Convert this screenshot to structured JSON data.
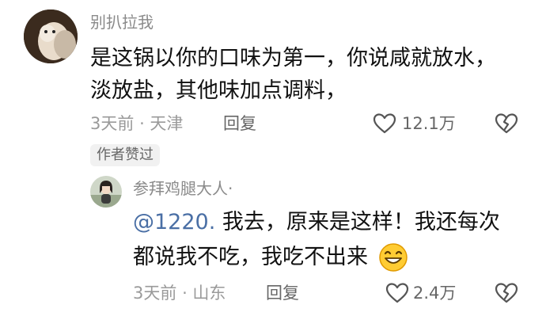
{
  "comment": {
    "author": "别扒拉我",
    "text_line1": "是这锅以你的口味为第一，你说咸就放水，",
    "text_line2": "淡放盐，其他味加点调料，",
    "time": "3天前",
    "location": "天津",
    "reply_label": "回复",
    "like_count": "12.1万",
    "author_liked_badge": "作者赞过"
  },
  "reply": {
    "author": "参拜鸡腿大人·",
    "mention": "@1220.",
    "text_line1_rest": " 我去，原来是这样！我还每次",
    "text_line2": "都说我不吃，我吃不出来",
    "emoji": "😁",
    "time": "3天前",
    "location": "山东",
    "reply_label": "回复",
    "like_count": "2.4万"
  },
  "colors": {
    "name": "#8a8a8a",
    "mention": "#4a6fa5",
    "meta": "#9a9a9a"
  },
  "icons": [
    "heart-icon",
    "broken-heart-icon",
    "grin-emoji"
  ]
}
